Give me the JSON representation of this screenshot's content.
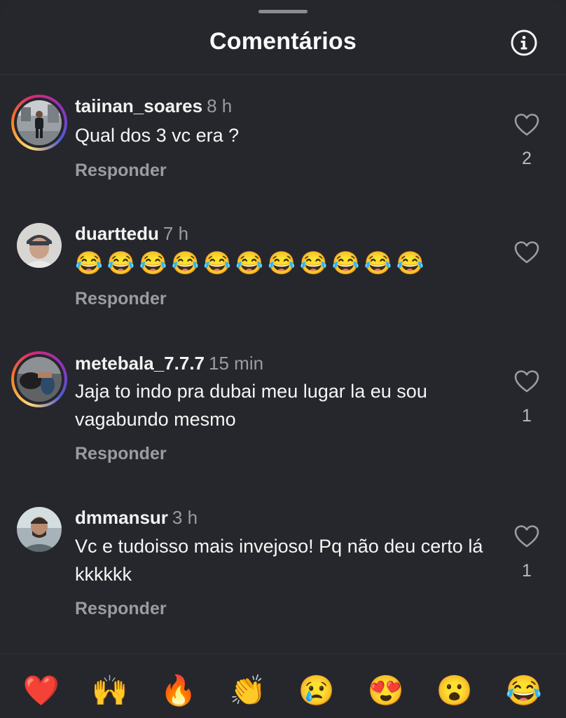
{
  "header": {
    "title": "Comentários",
    "info_icon": "info-icon"
  },
  "comments": [
    {
      "username": "taiinan_soares",
      "time": "8 h",
      "text": "Qual dos 3 vc era ?",
      "reply": "Responder",
      "likes": "2",
      "story_ring": true
    },
    {
      "username": "duarttedu",
      "time": "7 h",
      "text": "😂😂😂😂😂😂😂😂😂😂😂",
      "reply": "Responder",
      "likes": "",
      "story_ring": false
    },
    {
      "username": "metebala_7.7.7",
      "time": "15 min",
      "text": "Jaja to indo pra dubai meu lugar la eu sou vagabundo mesmo",
      "reply": "Responder",
      "likes": "1",
      "story_ring": true
    },
    {
      "username": "dmmansur",
      "time": "3 h",
      "text": "Vc e tudoisso mais invejoso! Pq não deu certo lá kkkkkk",
      "reply": "Responder",
      "likes": "1",
      "story_ring": false
    }
  ],
  "reactions": [
    "❤️",
    "🙌",
    "🔥",
    "👏",
    "😢",
    "😍",
    "😮",
    "😂"
  ],
  "colors": {
    "background": "#25272c",
    "text": "#f5f5f5",
    "muted": "#9a9ca1"
  }
}
